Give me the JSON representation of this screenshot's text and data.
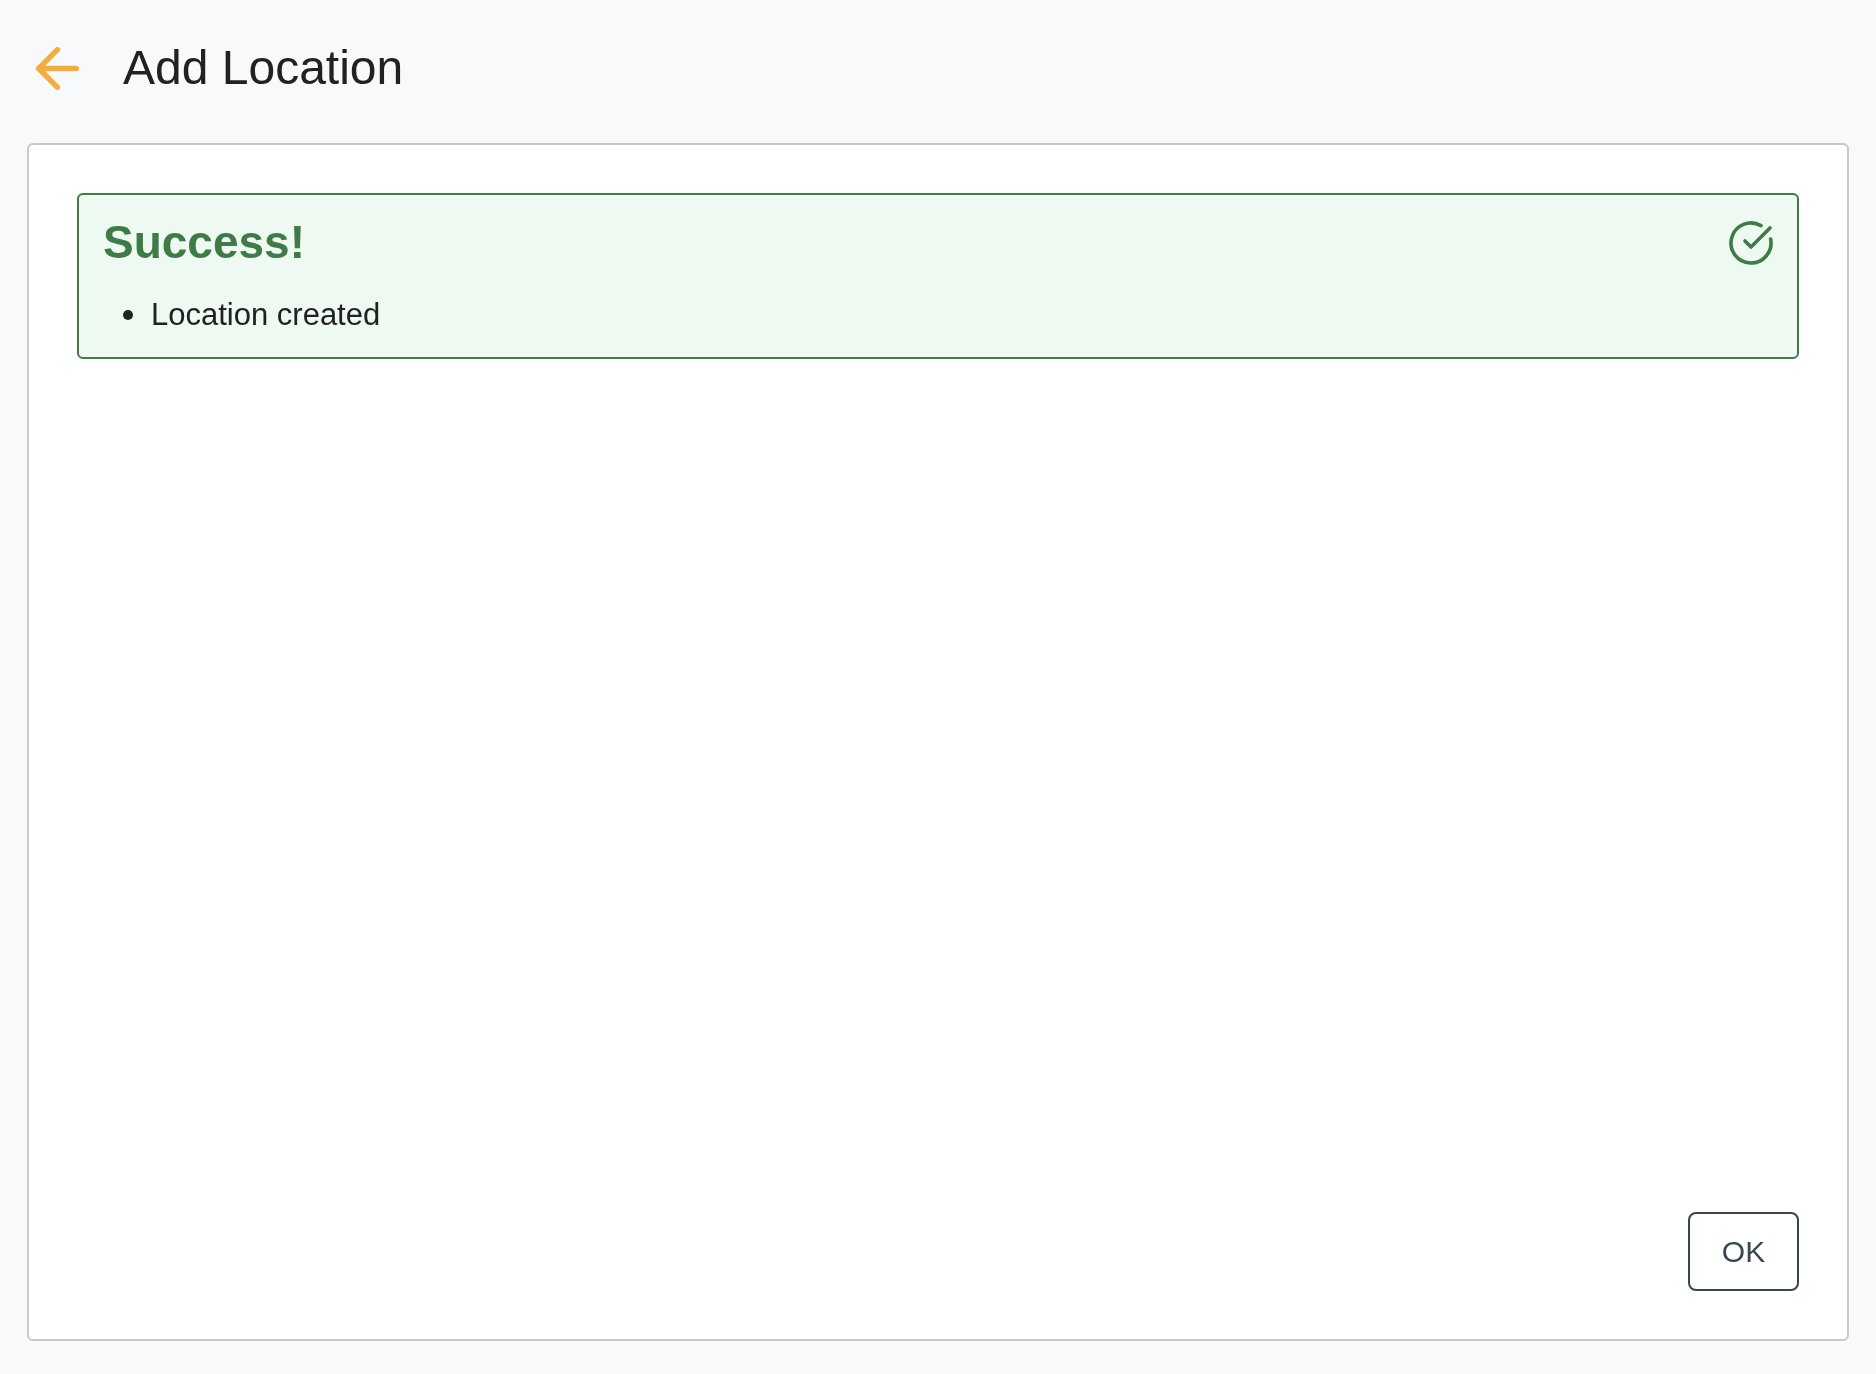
{
  "header": {
    "title": "Add Location"
  },
  "alert": {
    "kind": "success",
    "title": "Success!",
    "messages": [
      "Location created"
    ]
  },
  "actions": [
    {
      "label": "OK"
    }
  ]
}
